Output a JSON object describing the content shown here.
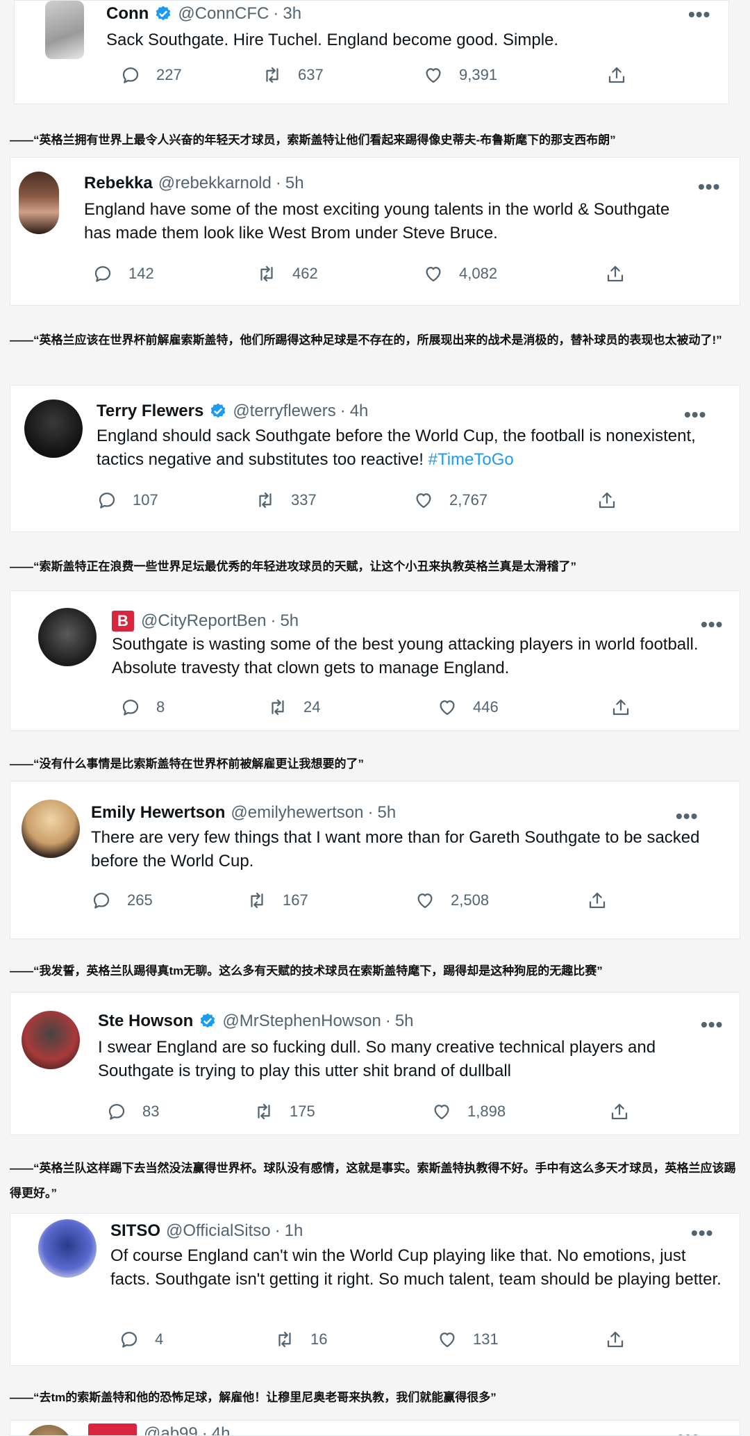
{
  "colors": {
    "accent": "#1d9bf0",
    "text": "#0f1419",
    "muted": "#536471",
    "badge": "#d7263d"
  },
  "tweets": [
    {
      "name": "Conn",
      "verified": true,
      "handle": "@ConnCFC",
      "time": "3h",
      "text": "Sack Southgate. Hire Tuchel. England become good. Simple.",
      "replies": "227",
      "retweets": "637",
      "likes": "9,391"
    },
    {
      "name": "Rebekka",
      "verified": false,
      "handle": "@rebekkarnold",
      "time": "5h",
      "text": "England have some of the most exciting young talents in the world & Southgate has made them look like West Brom under Steve Bruce.",
      "replies": "142",
      "retweets": "462",
      "likes": "4,082"
    },
    {
      "name": "Terry Flewers",
      "verified": true,
      "handle": "@terryflewers",
      "time": "4h",
      "text": "England should sack Southgate before the World Cup, the football is nonexistent, tactics negative and substitutes too reactive!",
      "hashtag": "#TimeToGo",
      "replies": "107",
      "retweets": "337",
      "likes": "2,767"
    },
    {
      "name_badge": "B",
      "verified": false,
      "handle": "@CityReportBen",
      "time": "5h",
      "text": "Southgate is wasting some of the best young attacking players in world football. Absolute travesty that clown gets to manage England.",
      "replies": "8",
      "retweets": "24",
      "likes": "446"
    },
    {
      "name": "Emily Hewertson",
      "verified": false,
      "handle": "@emilyhewertson",
      "time": "5h",
      "text": "There are very few things that I want more than for Gareth Southgate to be sacked before the World Cup.",
      "replies": "265",
      "retweets": "167",
      "likes": "2,508"
    },
    {
      "name": "Ste Howson",
      "verified": true,
      "handle": "@MrStephenHowson",
      "time": "5h",
      "text": "I swear England are so fucking dull. So many creative technical players and Southgate is trying to play this utter shit brand of dullball",
      "replies": "83",
      "retweets": "175",
      "likes": "1,898"
    },
    {
      "name": "SITSO",
      "verified": false,
      "handle": "@OfficialSitso",
      "time": "1h",
      "text": "Of course England can't win the World Cup playing like that. No emotions, just facts. Southgate isn't getting it right. So much talent, team should be playing better.",
      "replies": "4",
      "retweets": "16",
      "likes": "131"
    },
    {
      "handle": "@ab99",
      "time": "4h"
    }
  ],
  "captions": [
    "——“英格兰拥有世界上最令人兴奋的年轻天才球员，索斯盖特让他们看起来踢得像史蒂夫-布鲁斯麾下的那支西布朗”",
    "——“英格兰应该在世界杯前解雇索斯盖特，他们所踢得这种足球是不存在的，所展现出来的战术是消极的，替补球员的表现也太被动了!”",
    "——“索斯盖特正在浪费一些世界足坛最优秀的年轻进攻球员的天赋，让这个小丑来执教英格兰真是太滑稽了”",
    "——“没有什么事情是比索斯盖特在世界杯前被解雇更让我想要的了”",
    "——“我发誓，英格兰队踢得真tm无聊。这么多有天赋的技术球员在索斯盖特麾下，踢得却是这种狗屁的无趣比赛”",
    "——“英格兰队这样踢下去当然没法赢得世界杯。球队没有感情，这就是事实。索斯盖特执教得不好。手中有这么多天才球员，英格兰应该踢得更好。”",
    "——“去tm的索斯盖特和他的恐怖足球，解雇他！让穆里尼奥老哥来执教，我们就能赢得很多”"
  ],
  "more_label": "•••"
}
